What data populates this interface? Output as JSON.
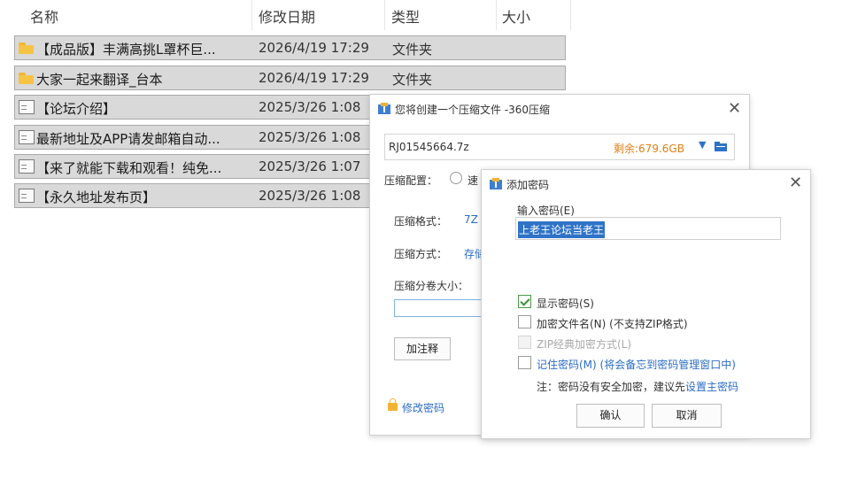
{
  "explorer": {
    "columns": {
      "name": "名称",
      "modified": "修改日期",
      "type": "类型",
      "size": "大小"
    },
    "rows": [
      {
        "icon": "folder-icon",
        "name": "【成品版】丰满高挑L罩杯巨...",
        "date": "2026/4/19 17:29",
        "type": "文件夹"
      },
      {
        "icon": "folder-icon",
        "name": "大家一起来翻译_台本",
        "date": "2026/4/19 17:29",
        "type": "文件夹"
      },
      {
        "icon": "document-icon",
        "name": "【论坛介绍】",
        "date": "2025/3/26 1:08",
        "type": ""
      },
      {
        "icon": "document-icon",
        "name": "最新地址及APP请发邮箱自动...",
        "date": "2025/3/26 1:08",
        "type": ""
      },
      {
        "icon": "document-icon",
        "name": "【来了就能下载和观看！纯免...",
        "date": "2025/3/26 1:07",
        "type": ""
      },
      {
        "icon": "document-icon",
        "name": "【永久地址发布页】",
        "date": "2025/3/26 1:08",
        "type": ""
      }
    ]
  },
  "compress_dialog": {
    "title": "您将创建一个压缩文件 -360压缩",
    "archive_name": "RJ01545664.7z",
    "free_space": "剩余:679.6GB",
    "config_label": "压缩配置：",
    "config_option_partial": "速",
    "format_label": "压缩格式：",
    "format_value": "7Z",
    "method_label": "压缩方式：",
    "method_value": "存储",
    "volume_label": "压缩分卷大小：",
    "comment_button": "加注释",
    "change_password": "修改密码"
  },
  "password_dialog": {
    "title": "添加密码",
    "input_label": "输入密码(E)",
    "password_value": "上老王论坛当老王",
    "options": [
      {
        "label": "显示密码(S)",
        "checked": true,
        "disabled": false
      },
      {
        "label": "加密文件名(N) (不支持ZIP格式)",
        "checked": false,
        "disabled": false
      },
      {
        "label": "ZIP经典加密方式(L)",
        "checked": false,
        "disabled": true
      }
    ],
    "remember_label": "记住密码(M)",
    "remember_hint": "(将会备忘到密码管理窗口中)",
    "note_prefix": "注：密码没有安全加密，建议先",
    "note_link": "设置主密码",
    "ok_button": "确认",
    "cancel_button": "取消"
  },
  "colors": {
    "accent": "#2b6cc4",
    "free_space": "#e07f14",
    "folder": "#f6c445",
    "row_selected": "#d9d9d9"
  }
}
